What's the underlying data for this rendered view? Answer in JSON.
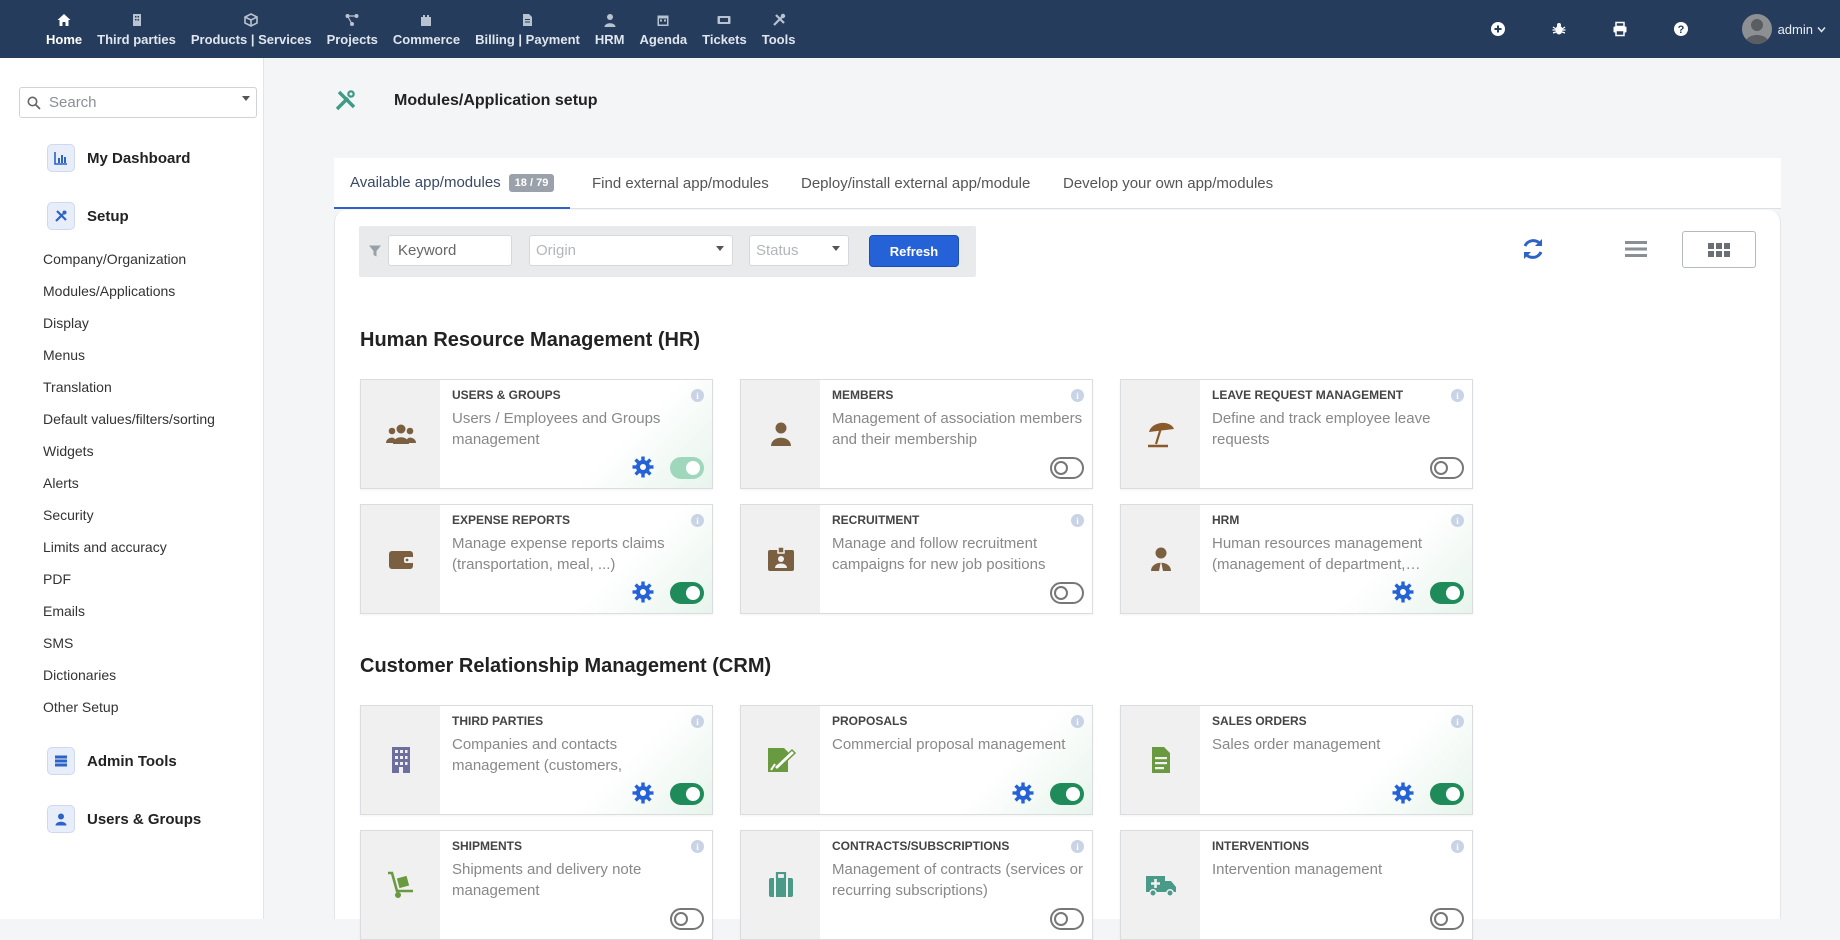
{
  "topnav": [
    {
      "label": "Home",
      "icon": "home-icon",
      "active": true
    },
    {
      "label": "Third parties",
      "icon": "building-icon"
    },
    {
      "label": "Products | Services",
      "icon": "cube-icon"
    },
    {
      "label": "Projects",
      "icon": "project-icon"
    },
    {
      "label": "Commerce",
      "icon": "commerce-icon"
    },
    {
      "label": "Billing | Payment",
      "icon": "invoice-icon"
    },
    {
      "label": "HRM",
      "icon": "person-icon"
    },
    {
      "label": "Agenda",
      "icon": "calendar-icon"
    },
    {
      "label": "Tickets",
      "icon": "ticket-icon"
    },
    {
      "label": "Tools",
      "icon": "tools-icon"
    }
  ],
  "topright": {
    "user": "admin"
  },
  "sidebar": {
    "search_placeholder": "Search",
    "groups": {
      "dashboard": "My Dashboard",
      "setup": "Setup",
      "admin_tools": "Admin Tools",
      "users_groups": "Users & Groups"
    },
    "setup_items": [
      "Company/Organization",
      "Modules/Applications",
      "Display",
      "Menus",
      "Translation",
      "Default values/filters/sorting",
      "Widgets",
      "Alerts",
      "Security",
      "Limits and accuracy",
      "PDF",
      "Emails",
      "SMS",
      "Dictionaries",
      "Other Setup"
    ]
  },
  "page": {
    "title": "Modules/Application setup"
  },
  "tabs": [
    {
      "label": "Available app/modules",
      "badge": "18 / 79",
      "active": true
    },
    {
      "label": "Find external app/modules"
    },
    {
      "label": "Deploy/install external app/module"
    },
    {
      "label": "Develop your own app/modules"
    }
  ],
  "filters": {
    "keyword_placeholder": "Keyword",
    "origin_placeholder": "Origin",
    "status_placeholder": "Status",
    "refresh_label": "Refresh"
  },
  "sections": [
    {
      "title": "Human Resource Management (HR)",
      "modules": [
        {
          "name": "USERS & GROUPS",
          "desc": "Users / Employees and Groups management",
          "icon": "users-icon",
          "icon_color": "#7a6040",
          "gear": true,
          "state": "enabled-fixed"
        },
        {
          "name": "MEMBERS",
          "desc": "Management of association members and their membership",
          "icon": "member-icon",
          "icon_color": "#7a6040",
          "gear": false,
          "state": "disabled"
        },
        {
          "name": "LEAVE REQUEST MANAGEMENT",
          "desc": "Define and track employee leave requests",
          "icon": "beach-umbrella-icon",
          "icon_color": "#8a5a2a",
          "gear": false,
          "state": "disabled"
        },
        {
          "name": "EXPENSE REPORTS",
          "desc": "Manage expense reports claims (transportation, meal, ...)",
          "icon": "wallet-icon",
          "icon_color": "#7a6040",
          "gear": true,
          "state": "enabled"
        },
        {
          "name": "RECRUITMENT",
          "desc": "Manage and follow recruitment campaigns for new job positions",
          "icon": "id-badge-icon",
          "icon_color": "#7a6040",
          "gear": false,
          "state": "disabled"
        },
        {
          "name": "HRM",
          "desc": "Human resources management (management of department,…",
          "icon": "employee-icon",
          "icon_color": "#7a6040",
          "gear": true,
          "state": "enabled"
        }
      ]
    },
    {
      "title": "Customer Relationship Management (CRM)",
      "modules": [
        {
          "name": "THIRD PARTIES",
          "desc": "Companies and contacts management (customers, prospects...)",
          "icon": "building-icon",
          "icon_color": "#6c6f9e",
          "gear": true,
          "state": "enabled"
        },
        {
          "name": "PROPOSALS",
          "desc": "Commercial proposal management",
          "icon": "proposal-icon",
          "icon_color": "#6a9a40",
          "gear": true,
          "state": "enabled"
        },
        {
          "name": "SALES ORDERS",
          "desc": "Sales order management",
          "icon": "order-icon",
          "icon_color": "#6a9a40",
          "gear": true,
          "state": "enabled"
        },
        {
          "name": "SHIPMENTS",
          "desc": "Shipments and delivery note management",
          "icon": "dolly-icon",
          "icon_color": "#6a9a40",
          "gear": false,
          "state": "disabled"
        },
        {
          "name": "CONTRACTS/SUBSCRIPTIONS",
          "desc": "Management of contracts (services or recurring subscriptions)",
          "icon": "suitcase-icon",
          "icon_color": "#4a9a8a",
          "gear": false,
          "state": "disabled"
        },
        {
          "name": "INTERVENTIONS",
          "desc": "Intervention management",
          "icon": "ambulance-icon",
          "icon_color": "#4a9a8a",
          "gear": false,
          "state": "disabled"
        }
      ]
    }
  ],
  "colors": {
    "topbar": "#263c5c",
    "accent": "#2562d8",
    "toggle_on": "#1f8b5a"
  }
}
